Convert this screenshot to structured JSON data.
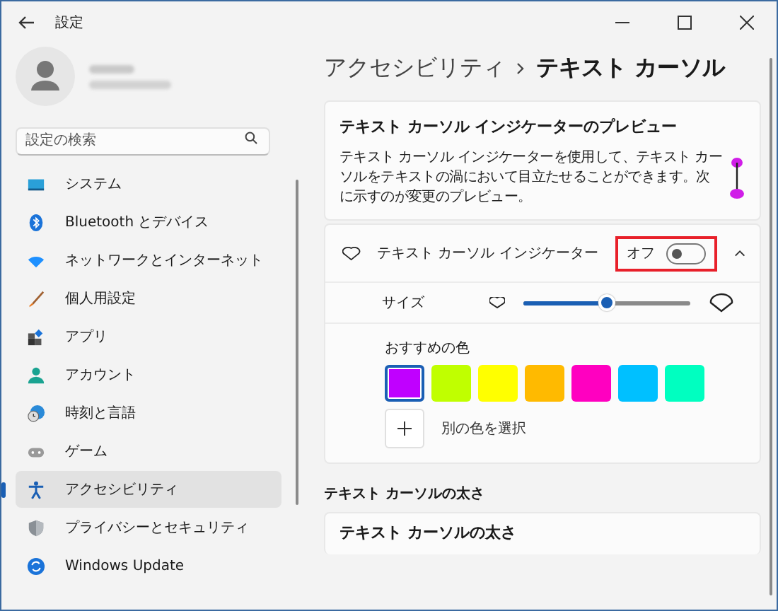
{
  "window": {
    "title": "設定"
  },
  "search": {
    "placeholder": "設定の検索"
  },
  "sidebar": {
    "items": [
      {
        "label": "システム",
        "selected": false
      },
      {
        "label": "Bluetooth とデバイス",
        "selected": false
      },
      {
        "label": "ネットワークとインターネット",
        "selected": false
      },
      {
        "label": "個人用設定",
        "selected": false
      },
      {
        "label": "アプリ",
        "selected": false
      },
      {
        "label": "アカウント",
        "selected": false
      },
      {
        "label": "時刻と言語",
        "selected": false
      },
      {
        "label": "ゲーム",
        "selected": false
      },
      {
        "label": "アクセシビリティ",
        "selected": true
      },
      {
        "label": "プライバシーとセキュリティ",
        "selected": false
      },
      {
        "label": "Windows Update",
        "selected": false
      }
    ]
  },
  "breadcrumb": {
    "parent": "アクセシビリティ",
    "current": "テキスト カーソル"
  },
  "preview": {
    "title": "テキスト カーソル インジケーターのプレビュー",
    "text": "テキスト カーソル インジケーターを使用して、テキスト カーソルをテキストの渦において目立たせることができます。次に示すのが変更のプレビュー。"
  },
  "indicator": {
    "label": "テキスト カーソル インジケーター",
    "state_text": "オフ",
    "on": false,
    "expanded": true,
    "highlighted": true
  },
  "size": {
    "label": "サイズ",
    "level": 0.5
  },
  "colors": {
    "label": "おすすめの色",
    "swatches": [
      {
        "color": "#c000ff",
        "selected": true
      },
      {
        "color": "#c0ff00",
        "selected": false
      },
      {
        "color": "#ffff00",
        "selected": false
      },
      {
        "color": "#ffba00",
        "selected": false
      },
      {
        "color": "#ff00c0",
        "selected": false
      },
      {
        "color": "#00c0ff",
        "selected": false
      },
      {
        "color": "#00ffc0",
        "selected": false
      }
    ],
    "custom": "別の色を選択"
  },
  "thickness": {
    "heading": "テキスト カーソルの太さ",
    "card_title": "テキスト カーソルの太さ"
  }
}
